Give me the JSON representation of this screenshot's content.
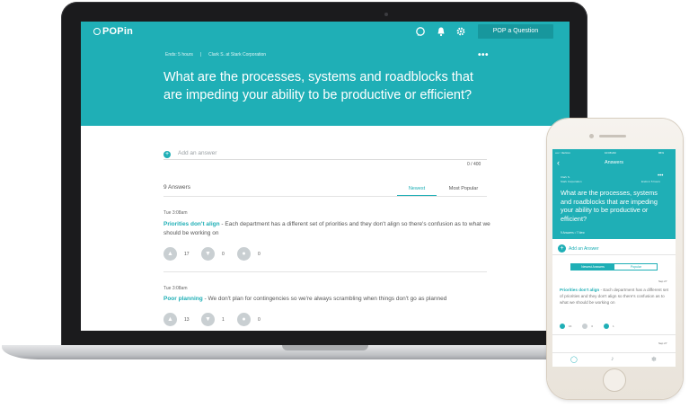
{
  "laptop": {
    "logo": "POPin",
    "pop_button": "POP a Question",
    "meta_ends": "Ends: 5 hours",
    "meta_separator": "|",
    "meta_author": "Clark S. at Stark Corporation",
    "more": "•••",
    "question": "What are the processes, systems and roadblocks that are impeding your ability to be productive or efficient?",
    "add_placeholder": "Add an answer",
    "counter": "0 / 400",
    "answers_count": "9 Answers",
    "tabs": {
      "newest": "Newest",
      "popular": "Most Popular"
    },
    "answers": [
      {
        "time": "Tue 3:08am",
        "title": "Priorities don't align",
        "body": " - Each department has a different set of priorities and they don't align so there's confusion as to what we should be working on",
        "likes": "17",
        "dislikes": "0",
        "comments": "0"
      },
      {
        "time": "Tue 3:08am",
        "title": "Poor planning",
        "body": " - We don't plan for contingencies so we're always scrambling when things don't go as planned",
        "likes": "13",
        "dislikes": "1",
        "comments": "0"
      }
    ]
  },
  "phone": {
    "status_carrier": "••••○ Verizon",
    "status_time": "10:08 AM",
    "status_battery": "86%",
    "nav_title": "Answers",
    "author": "Clark S.",
    "company": "Stark Corporation",
    "ends": "Ends in 5 hours",
    "more": "•••",
    "question": "What are the processes, systems and roadblocks that are impeding your ability to be productive or efficient?",
    "stats": "9 Answers  •  7 New",
    "add_label": "Add an Answer",
    "tabs": {
      "newest": "Newest Answers",
      "popular": "Popular"
    },
    "date1": "Sep 27",
    "answer_title": "Priorities don't align",
    "answer_body": " - Each department has a different set of priorities and they don't align so there's confusion as to what we should be working on",
    "likes": "16",
    "dislikes": "0",
    "comments": "1",
    "date2": "Sep 27"
  },
  "colors": {
    "accent": "#1fafb6",
    "accent_dark": "#17979d"
  }
}
